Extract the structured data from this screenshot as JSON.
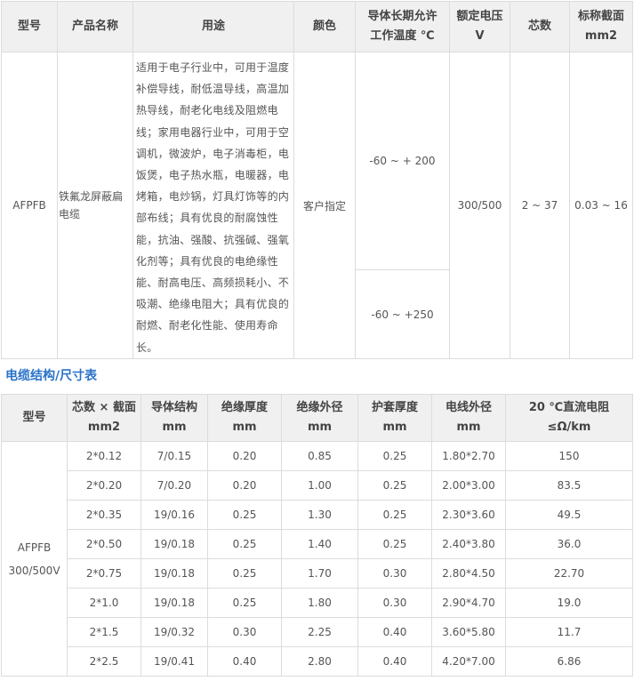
{
  "table1": {
    "headers": [
      "型号",
      "产品名称",
      "用途",
      "颜色",
      "导体长期允许",
      "工作温度 ℃",
      "额定电压",
      "V",
      "芯数",
      "标称截面",
      "mm2"
    ],
    "model": "AFPFB",
    "product_name": "铁氟龙屏蔽扁电缆",
    "usage": "适用于电子行业中，可用于温度补偿导线，耐低温导线，高温加热导线，耐老化电线及阻燃电线；家用电器行业中，可用于空调机，微波炉，电子消毒柜，电饭煲，电子热水瓶，电暖器，电烤箱，电炒锅，灯具灯饰等的内部布线；具有优良的耐腐蚀性能，抗油、强酸、抗强碱、强氧化剂等；具有优良的电绝缘性能、耐高电压、高频损耗小、不吸潮、绝缘电阻大；具有优良的耐燃、耐老化性能、使用寿命长。",
    "color": "客户指定",
    "temps": [
      "-60 ~ + 200",
      "-60 ~ +250"
    ],
    "voltage": "300/500",
    "cores": "2 ~ 37",
    "section": "0.03 ~ 16"
  },
  "section_title": "电缆结构/尺寸表",
  "table2": {
    "headers": [
      [
        "型号"
      ],
      [
        "芯数 × 截面",
        "mm2"
      ],
      [
        "导体结构",
        "mm"
      ],
      [
        "绝缘厚度",
        "mm"
      ],
      [
        "绝缘外径",
        "mm"
      ],
      [
        "护套厚度",
        "mm"
      ],
      [
        "电线外径",
        "mm"
      ],
      [
        "20 ℃直流电阻",
        "≤Ω/km"
      ]
    ],
    "model_lines": [
      "AFPFB",
      "300/500V"
    ],
    "rows": [
      [
        "2*0.12",
        "7/0.15",
        "0.20",
        "0.85",
        "0.25",
        "1.80*2.70",
        "150"
      ],
      [
        "2*0.20",
        "7/0.20",
        "0.20",
        "1.00",
        "0.25",
        "2.00*3.00",
        "83.5"
      ],
      [
        "2*0.35",
        "19/0.16",
        "0.25",
        "1.30",
        "0.25",
        "2.30*3.60",
        "49.5"
      ],
      [
        "2*0.50",
        "19/0.18",
        "0.25",
        "1.40",
        "0.25",
        "2.40*3.80",
        "36.0"
      ],
      [
        "2*0.75",
        "19/0.18",
        "0.25",
        "1.70",
        "0.30",
        "2.80*4.50",
        "22.70"
      ],
      [
        "2*1.0",
        "19/0.18",
        "0.25",
        "1.80",
        "0.30",
        "2.90*4.70",
        "19.0"
      ],
      [
        "2*1.5",
        "19/0.32",
        "0.30",
        "2.25",
        "0.40",
        "3.60*5.80",
        "11.7"
      ],
      [
        "2*2.5",
        "19/0.41",
        "0.40",
        "2.80",
        "0.40",
        "4.20*7.00",
        "6.86"
      ]
    ]
  }
}
